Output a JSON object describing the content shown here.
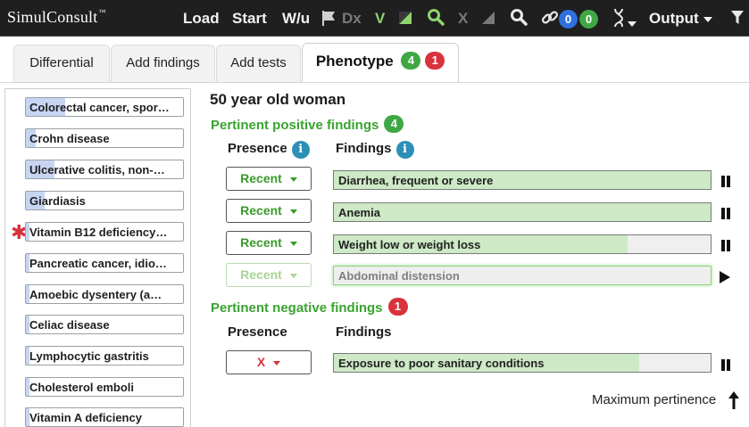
{
  "app": {
    "logo": "SimulConsult",
    "logo_mark": "™"
  },
  "toolbar": {
    "load": "Load",
    "start": "Start",
    "wu": "W/u",
    "dx": "Dx",
    "v": "V",
    "x": "X",
    "link_count_blue": "0",
    "link_count_green": "0",
    "output": "Output"
  },
  "tabs": [
    {
      "label": "Differential"
    },
    {
      "label": "Add findings"
    },
    {
      "label": "Add tests"
    },
    {
      "label": "Phenotype",
      "badge_positive": "4",
      "badge_negative": "1"
    }
  ],
  "differential": [
    {
      "label": "Colorectal cancer, spor…",
      "level": 0.25,
      "flagged": false
    },
    {
      "label": "Crohn disease",
      "level": 0.06,
      "flagged": false
    },
    {
      "label": "Ulcerative colitis, non-…",
      "level": 0.18,
      "flagged": false
    },
    {
      "label": "Giardiasis",
      "level": 0.12,
      "flagged": false
    },
    {
      "label": "Vitamin B12 deficiency…",
      "level": 0.02,
      "flagged": true
    },
    {
      "label": "Pancreatic cancer, idio…",
      "level": 0.02,
      "flagged": false
    },
    {
      "label": "Amoebic dysentery (a…",
      "level": 0.02,
      "flagged": false
    },
    {
      "label": "Celiac disease",
      "level": 0.02,
      "flagged": false
    },
    {
      "label": "Lymphocytic gastritis",
      "level": 0.02,
      "flagged": false
    },
    {
      "label": "Cholesterol emboli",
      "level": 0.02,
      "flagged": false
    },
    {
      "label": "Vitamin A deficiency",
      "level": 0.02,
      "flagged": false
    }
  ],
  "patient": {
    "title": "50 year old woman"
  },
  "positive": {
    "heading": "Pertinent positive findings",
    "count": "4",
    "col_presence": "Presence",
    "col_findings": "Findings",
    "info_glyph": "i",
    "rows": [
      {
        "presence": "Recent",
        "finding": "Diarrhea, frequent or severe",
        "pertinence": 1.0,
        "control": "pause",
        "dim": false
      },
      {
        "presence": "Recent",
        "finding": "Anemia",
        "pertinence": 1.0,
        "control": "pause",
        "dim": false
      },
      {
        "presence": "Recent",
        "finding": "Weight low or weight loss",
        "pertinence": 0.78,
        "control": "pause",
        "dim": false
      },
      {
        "presence": "Recent",
        "finding": "Abdominal distension",
        "pertinence": 0.0,
        "control": "play",
        "dim": true
      }
    ]
  },
  "negative": {
    "heading": "Pertinent negative findings",
    "count": "1",
    "col_presence": "Presence",
    "col_findings": "Findings",
    "rows": [
      {
        "presence": "X",
        "finding": "Exposure to poor sanitary conditions",
        "pertinence": 0.81,
        "control": "pause"
      }
    ]
  },
  "footer": {
    "max_pertinence": "Maximum pertinence"
  },
  "colors": {
    "accent_green": "#39a32f",
    "badge_red": "#d8323c",
    "badge_green": "#3fa845",
    "badge_blue": "#2f6fe0",
    "info_blue": "#2d8fb6",
    "finding_fill": "#cde9c5",
    "dx_fill": "#c7d5f3"
  }
}
